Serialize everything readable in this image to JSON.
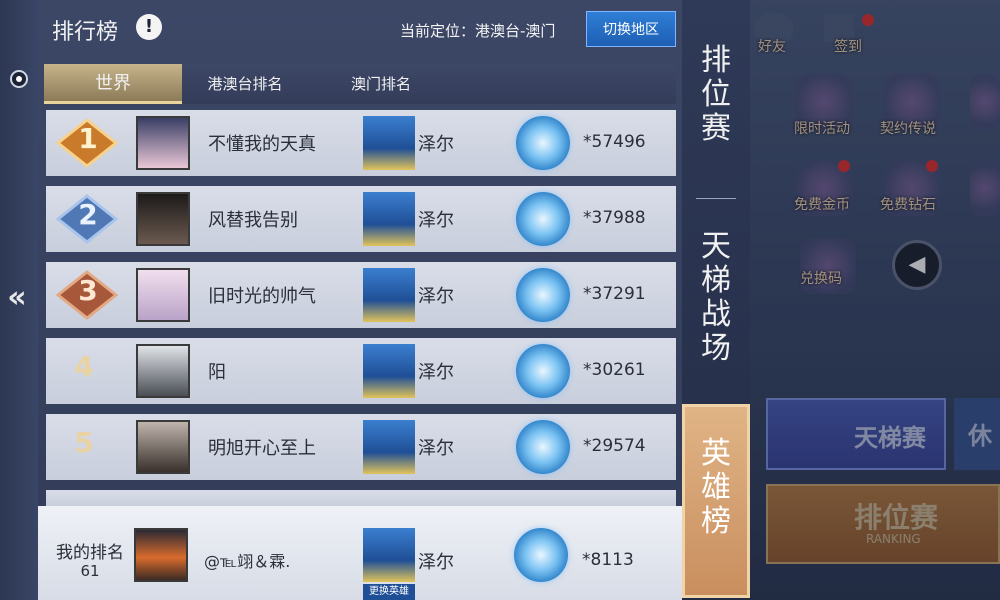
{
  "header": {
    "title": "排行榜",
    "info_icon": "!",
    "location": "当前定位：港澳台-澳门",
    "switch_region": "切换地区"
  },
  "tabs": [
    {
      "label": "世界",
      "active": true
    },
    {
      "label": "港澳台排名",
      "active": false
    },
    {
      "label": "澳门排名",
      "active": false
    }
  ],
  "rows": [
    {
      "rank": "1",
      "name": "不懂我的天真",
      "hero": "泽尔",
      "score": "*57496"
    },
    {
      "rank": "2",
      "name": "风替我告别",
      "hero": "泽尔",
      "score": "*37988"
    },
    {
      "rank": "3",
      "name": "旧时光的帅气",
      "hero": "泽尔",
      "score": "*37291"
    },
    {
      "rank": "4",
      "name": "阳",
      "hero": "泽尔",
      "score": "*30261"
    },
    {
      "rank": "5",
      "name": "明旭开心至上",
      "hero": "泽尔",
      "score": "*29574"
    }
  ],
  "my_rank": {
    "label": "我的排名",
    "rank": "61",
    "name": "@℡翊＆霖.",
    "hero": "泽尔",
    "score": "*8113",
    "change_hero": "更换英雄"
  },
  "side_tabs": [
    {
      "label": "排位赛",
      "active": false
    },
    {
      "label": "天梯战场",
      "active": false
    },
    {
      "label": "英雄榜",
      "active": true
    }
  ],
  "background_ui": {
    "friends": "好友",
    "checkin": "签到",
    "limited_event": "限时活动",
    "contract_legend": "契约传说",
    "free_gold": "免费金币",
    "free_diamond": "免费钻石",
    "redeem_code": "兑换码",
    "ladder_btn": "天梯赛",
    "leisure_btn": "休",
    "ranked_btn": "排位赛",
    "ranked_sub": "RANKING"
  },
  "colors": {
    "panel": "#3c4766",
    "row": "#d9dde8",
    "active_tab": "#c7b48b",
    "switch_button": "#2f7ed6",
    "hero_tab": "#e0b486"
  }
}
